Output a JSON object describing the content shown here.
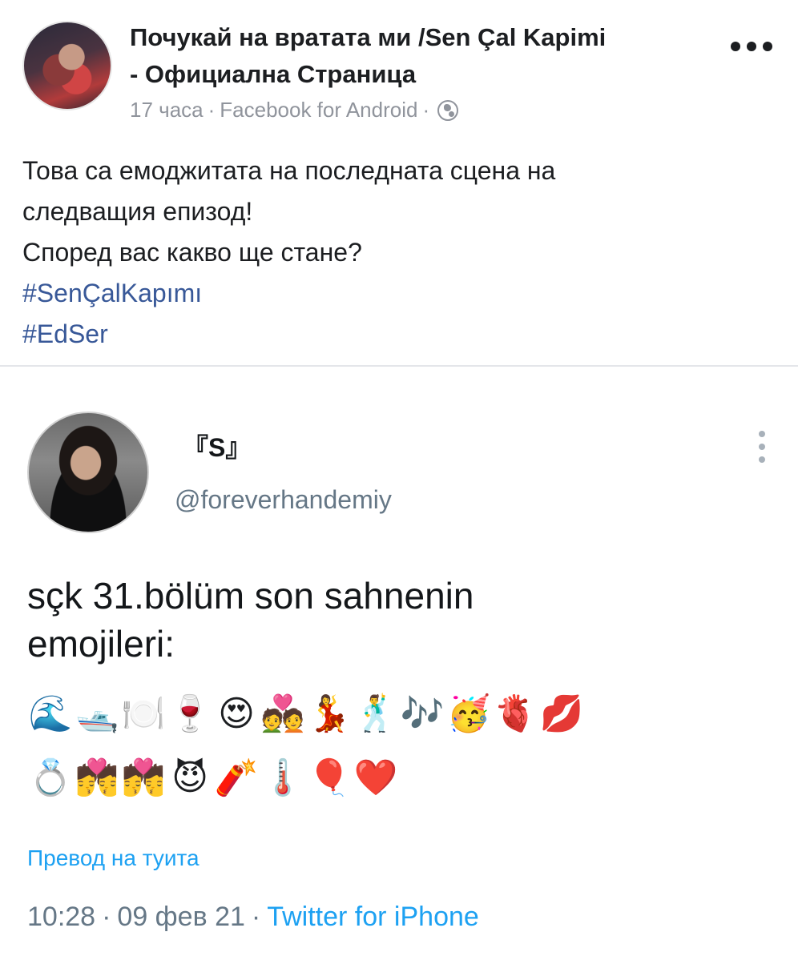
{
  "post": {
    "page_name_line1": "Почукай на вратата ми /Sen Çal Kapimi",
    "page_name_line2": "- Официална Страница",
    "time": "17 часа",
    "sep1": "·",
    "source": "Facebook for Android",
    "sep2": "·",
    "privacy_icon": "globe-icon",
    "more_icon": "more-horizontal-icon",
    "text_lines": [
      "Това са емоджитата на последната сцена на",
      "следващия епизод!",
      "Според вас какво ще стане?"
    ],
    "hashtags": [
      "#SenÇalKapımı",
      "#EdSer"
    ]
  },
  "tweet": {
    "display_name": "『S』",
    "handle": "@foreverhandemiy",
    "more_icon": "more-vertical-icon",
    "text_lines": [
      "sçk 31.bölüm son sahnenin",
      "emojileri:"
    ],
    "emoji_row1": [
      "🌊",
      "🛥️",
      "🍽️",
      "🍷",
      "😍",
      "💑",
      "💃",
      "🕺",
      "🎶",
      "🥳",
      "🫀",
      "💋"
    ],
    "emoji_row2": [
      "💍",
      "💏",
      "💏",
      "😈",
      "🧨",
      "🌡️",
      "🎈",
      "❤️"
    ],
    "translate_label": "Превод на туита",
    "time": "10:28",
    "sep1": "·",
    "date": "09 фев 21",
    "sep2": "·",
    "source": "Twitter for iPhone"
  }
}
